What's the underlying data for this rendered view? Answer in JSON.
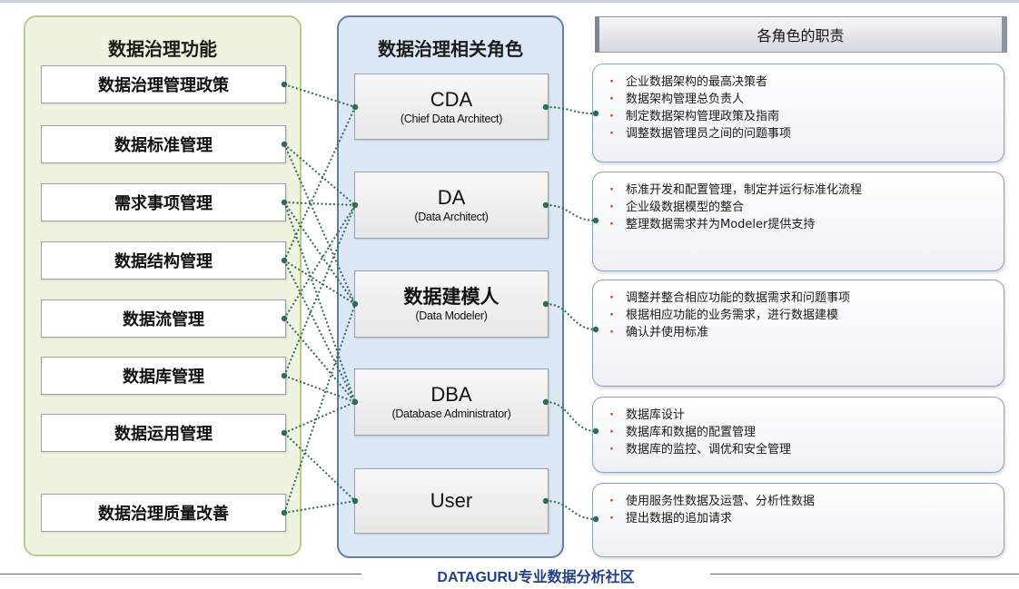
{
  "functions": {
    "title": "数据治理功能",
    "items": [
      {
        "label": "数据治理管理政策"
      },
      {
        "label": "数据标准管理"
      },
      {
        "label": "需求事项管理"
      },
      {
        "label": "数据结构管理"
      },
      {
        "label": "数据流管理"
      },
      {
        "label": "数据库管理"
      },
      {
        "label": "数据运用管理"
      },
      {
        "label": "数据治理质量改善"
      }
    ]
  },
  "roles": {
    "title": "数据治理相关角色",
    "items": [
      {
        "name": "CDA",
        "full": "(Chief Data Architect)"
      },
      {
        "name": "DA",
        "full": "(Data Architect)"
      },
      {
        "name": "数据建模人",
        "full": "(Data Modeler)"
      },
      {
        "name": "DBA",
        "full": "(Database Administrator)"
      },
      {
        "name": "User",
        "full": ""
      }
    ]
  },
  "responsibilities": {
    "title": "各角色的职责",
    "items": [
      {
        "lines": [
          "企业数据架构的最高决策者",
          "数据架构管理总负责人",
          "制定数据架构管理政策及指南",
          "调整数据管理员之间的问题事项"
        ]
      },
      {
        "lines": [
          "标准开发和配置管理，制定并运行标准化流程",
          "企业级数据模型的整合",
          "整理数据需求并为Modeler提供支持"
        ]
      },
      {
        "lines": [
          "调整并整合相应功能的数据需求和问题事项",
          "根据相应功能的业务需求，进行数据建模",
          "确认并使用标准"
        ]
      },
      {
        "lines": [
          "数据库设计",
          "数据库和数据的配置管理",
          "数据库的监控、调优和安全管理"
        ]
      },
      {
        "lines": [
          "使用服务性数据及运营、分析性数据",
          "提出数据的追加请求"
        ]
      }
    ]
  },
  "connections": [
    {
      "from": "数据治理管理政策",
      "to": "CDA"
    },
    {
      "from": "数据标准管理",
      "to": "DA"
    },
    {
      "from": "数据标准管理",
      "to": "数据建模人"
    },
    {
      "from": "需求事项管理",
      "to": "DA"
    },
    {
      "from": "需求事项管理",
      "to": "数据建模人"
    },
    {
      "from": "需求事项管理",
      "to": "DBA"
    },
    {
      "from": "数据结构管理",
      "to": "CDA"
    },
    {
      "from": "数据结构管理",
      "to": "数据建模人"
    },
    {
      "from": "数据结构管理",
      "to": "DBA"
    },
    {
      "from": "数据流管理",
      "to": "DA"
    },
    {
      "from": "数据流管理",
      "to": "DBA"
    },
    {
      "from": "数据库管理",
      "to": "DA"
    },
    {
      "from": "数据库管理",
      "to": "DBA"
    },
    {
      "from": "数据运用管理",
      "to": "DBA"
    },
    {
      "from": "数据运用管理",
      "to": "User"
    },
    {
      "from": "数据治理质量改善",
      "to": "数据建模人"
    },
    {
      "from": "数据治理质量改善",
      "to": "User"
    }
  ],
  "colors": {
    "connector": "#2e6b4f",
    "bullet": "#d04030",
    "footer": "#1f3f8f"
  },
  "footer": {
    "text": "DATAGURU专业数据分析社区"
  }
}
